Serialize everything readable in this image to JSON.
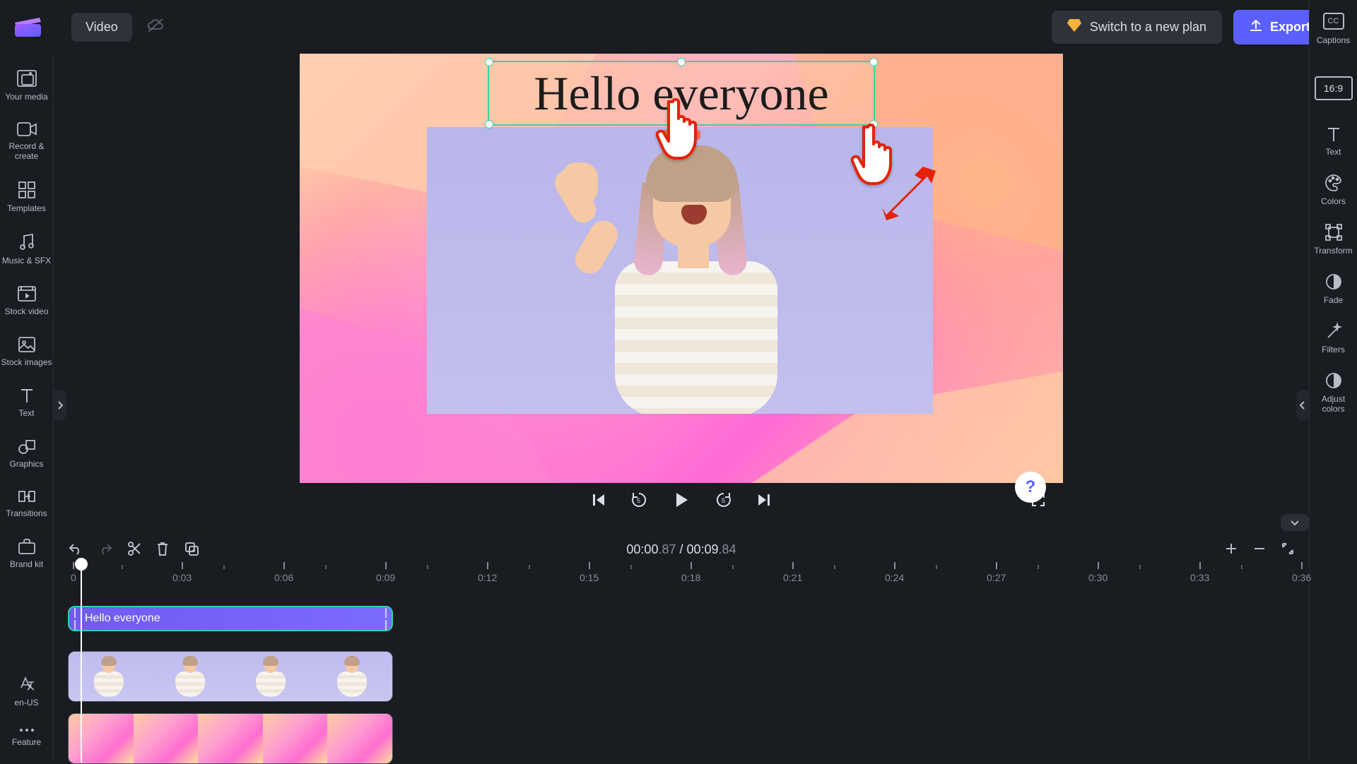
{
  "topbar": {
    "video_label": "Video",
    "plan_label": "Switch to a new plan",
    "export_label": "Export"
  },
  "left_sidebar": {
    "your_media": "Your media",
    "record_create": "Record & create",
    "templates": "Templates",
    "music_sfx": "Music & SFX",
    "stock_video": "Stock video",
    "stock_images": "Stock images",
    "text": "Text",
    "graphics": "Graphics",
    "transitions": "Transitions",
    "brand_kit": "Brand kit",
    "lang": "en-US",
    "feature": "Feature"
  },
  "right_sidebar": {
    "captions": "Captions",
    "aspect": "16:9",
    "text": "Text",
    "colors": "Colors",
    "transform": "Transform",
    "fade": "Fade",
    "filters": "Filters",
    "adjust_colors": "Adjust colors"
  },
  "canvas": {
    "overlay_text": "Hello everyone"
  },
  "timecode": {
    "current": "00:00",
    "current_frac": ".87",
    "total": "00:09",
    "total_frac": ".84",
    "sep": " / "
  },
  "ruler": [
    "0",
    "0:03",
    "0:06",
    "0:09",
    "0:12",
    "0:15",
    "0:18",
    "0:21",
    "0:24",
    "0:27",
    "0:30",
    "0:33",
    "0:36"
  ],
  "timeline": {
    "text_clip_label": "Hello everyone"
  }
}
